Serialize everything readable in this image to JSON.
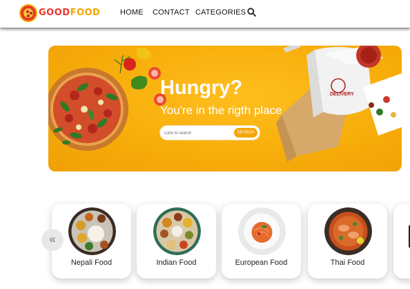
{
  "brand": {
    "part1": "GOOD",
    "part2": "FOOD"
  },
  "nav": {
    "home": "HOME",
    "contact": "CONTACT",
    "categories": "CATEGORIES"
  },
  "hero": {
    "title": "Hungry?",
    "subtitle": "You're in the rigth place",
    "search_placeholder": "Click to search",
    "search_button": "SEARCH",
    "box_text": "DELIVERY"
  },
  "carousel": {
    "prev_label": "«",
    "items": [
      {
        "label": "Nepali Food"
      },
      {
        "label": "Indian Food"
      },
      {
        "label": "European Food"
      },
      {
        "label": "Thai Food"
      }
    ]
  },
  "colors": {
    "accent": "#f6a50a",
    "brand_red": "#e8352a",
    "hero_bg": "#f7ad0a"
  }
}
